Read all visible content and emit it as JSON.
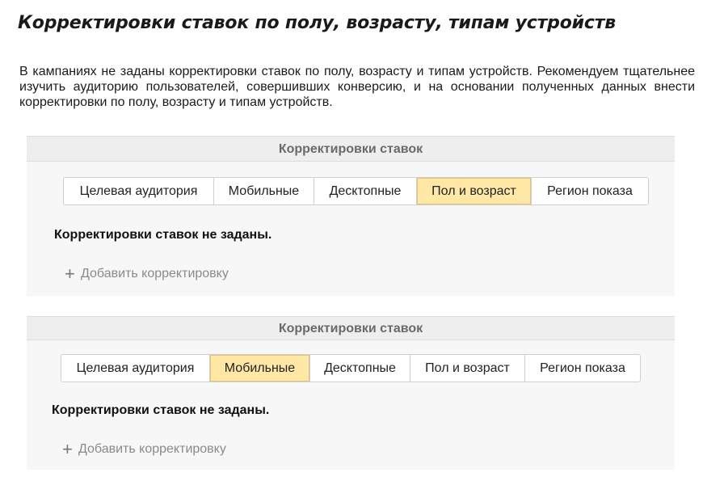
{
  "title": "Корректировки ставок по полу, возрасту, типам устройств",
  "intro": "В кампаниях не заданы корректировки ставок по полу, возрасту и типам устройств. Рекомендуем тщательнее изучить аудиторию пользователей, совершивших конверсию, и на основании полученных данных внести корректировки по полу, возрасту и типам устройств.",
  "panels": [
    {
      "header": "Корректировки ставок",
      "tabs": [
        "Целевая аудитория",
        "Мобильные",
        "Десктопные",
        "Пол и возраст",
        "Регион показа"
      ],
      "active_tab": "Пол и возраст",
      "empty_message": "Корректировки ставок не заданы.",
      "add_label": "Добавить корректировку",
      "add_icon": "plus-icon"
    },
    {
      "header": "Корректировки ставок",
      "tabs": [
        "Целевая аудитория",
        "Мобильные",
        "Десктопные",
        "Пол и возраст",
        "Регион показа"
      ],
      "active_tab": "Мобильные",
      "empty_message": "Корректировки ставок не заданы.",
      "add_label": "Добавить корректировку",
      "add_icon": "plus-icon"
    }
  ],
  "colors": {
    "active_tab": "#ffe7a6",
    "panel_bg": "#f7f7f7",
    "header_bg": "#eeeeee"
  }
}
